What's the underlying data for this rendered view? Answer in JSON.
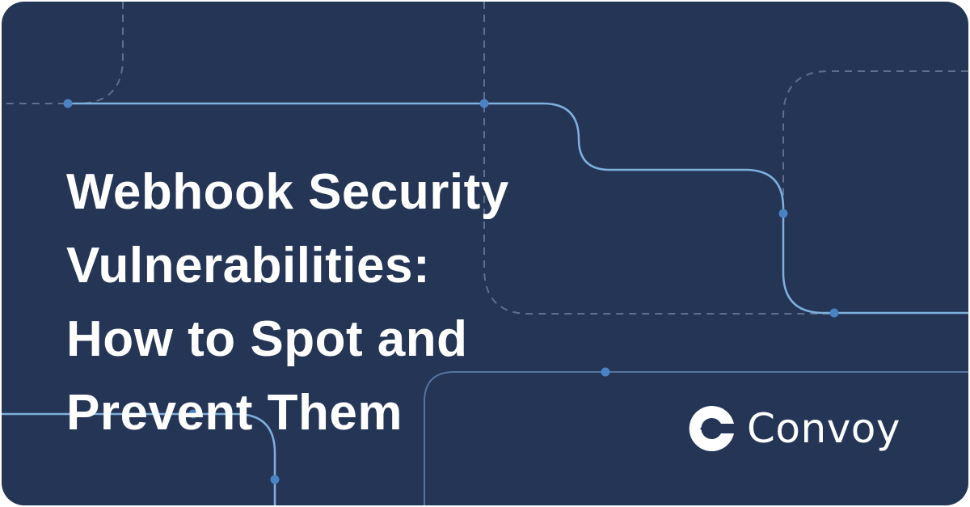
{
  "title_lines": [
    "Webhook Security",
    "Vulnerabilities:",
    "How to Spot and",
    "Prevent Them"
  ],
  "brand": {
    "name": "Convoy",
    "logo_icon": "convoy-logo-icon"
  },
  "colors": {
    "background": "#243556",
    "line": "#7fb0de",
    "dot": "#4a82c4",
    "dashed": "#5f6f8e",
    "text": "#ffffff"
  }
}
